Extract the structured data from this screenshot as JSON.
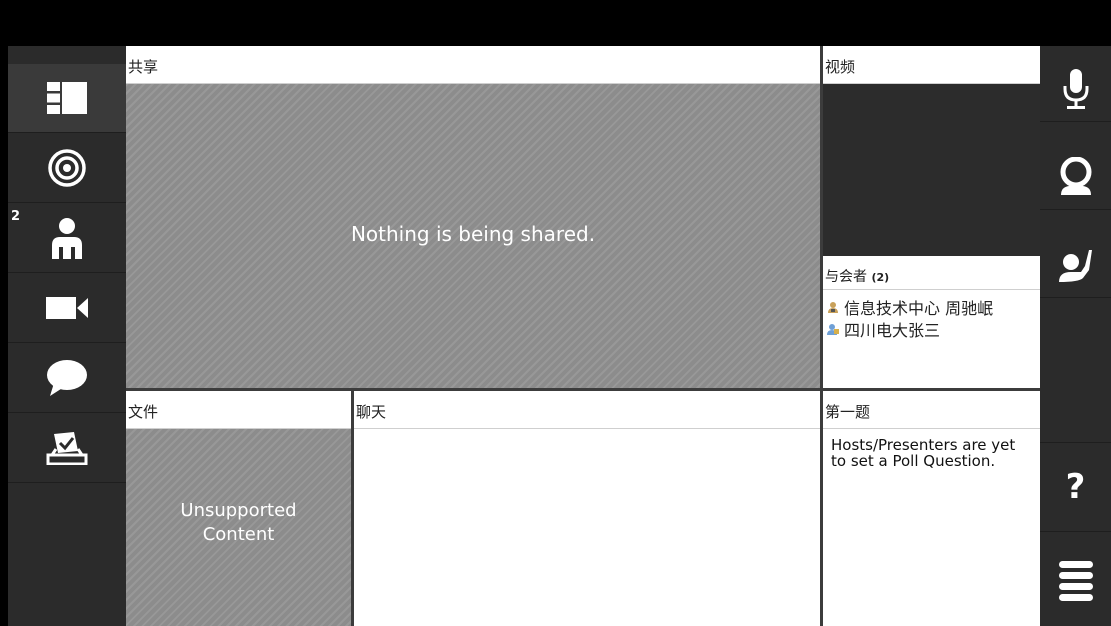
{
  "share": {
    "header": "共享",
    "message": "Nothing is being shared."
  },
  "video": {
    "header": "视频"
  },
  "participants": {
    "header": "与会者",
    "count": "(2)",
    "items": [
      {
        "name": "信息技术中心 周驰岷",
        "icon": "presenter-user-icon"
      },
      {
        "name": "四川电大张三",
        "icon": "attendee-user-icon"
      }
    ]
  },
  "files": {
    "header": "文件",
    "message_line1": "Unsupported",
    "message_line2": "Content"
  },
  "chat": {
    "header": "聊天"
  },
  "poll": {
    "header": "第一题",
    "message": "Hosts/Presenters are yet to set a Poll Question."
  },
  "leftbar": {
    "items": [
      {
        "name": "layout-icon",
        "active": true
      },
      {
        "name": "target-icon"
      },
      {
        "name": "attendees-icon",
        "badge": "2"
      },
      {
        "name": "video-camera-icon"
      },
      {
        "name": "chat-bubble-icon"
      },
      {
        "name": "poll-icon"
      }
    ]
  },
  "rightbar": {
    "items": [
      "microphone-icon",
      "webcam-icon",
      "raise-hand-icon",
      "help-icon",
      "menu-icon"
    ],
    "help_label": "?"
  }
}
